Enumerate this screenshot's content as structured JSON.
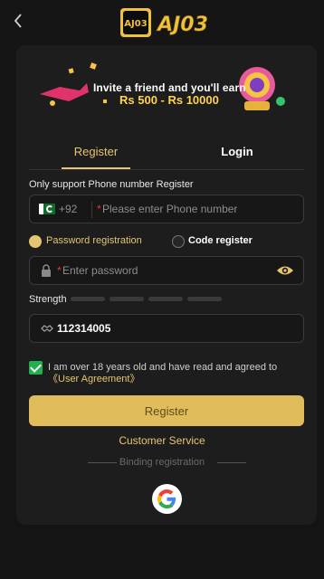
{
  "header": {
    "back_icon": "chevron-left-icon",
    "logo_text": "AJ03"
  },
  "banner": {
    "line1": "Invite a friend and you'll earn",
    "line2": "Rs 500 - Rs 10000"
  },
  "tabs": [
    {
      "label": "Register",
      "active": true
    },
    {
      "label": "Login",
      "active": false
    }
  ],
  "phone": {
    "section_label": "Only support Phone number Register",
    "country_code": "+92",
    "required_mark": "*",
    "placeholder": "Please enter Phone number",
    "flag_icon": "pakistan-flag-icon"
  },
  "modes": {
    "password_label": "Password registration",
    "code_label": "Code register"
  },
  "password": {
    "required_mark": "*",
    "placeholder": "Enter password",
    "lock_icon": "lock-icon",
    "eye_icon": "eye-icon"
  },
  "strength": {
    "label": "Strength",
    "segments": 4,
    "level": 0
  },
  "referral": {
    "value": "112314005",
    "icon": "handshake-icon"
  },
  "agreement": {
    "checked": true,
    "text": "I am over 18 years old and have read and agreed to ",
    "link": "《User Agreement》"
  },
  "register_button": {
    "label": "Register"
  },
  "customer_service": {
    "label": "Customer Service"
  },
  "binding": {
    "label": "Binding registration"
  },
  "colors": {
    "accent": "#e6c571",
    "button": "#e0bc5b",
    "check": "#1fb24c",
    "background": "#141414",
    "card": "#1d1d1d"
  }
}
